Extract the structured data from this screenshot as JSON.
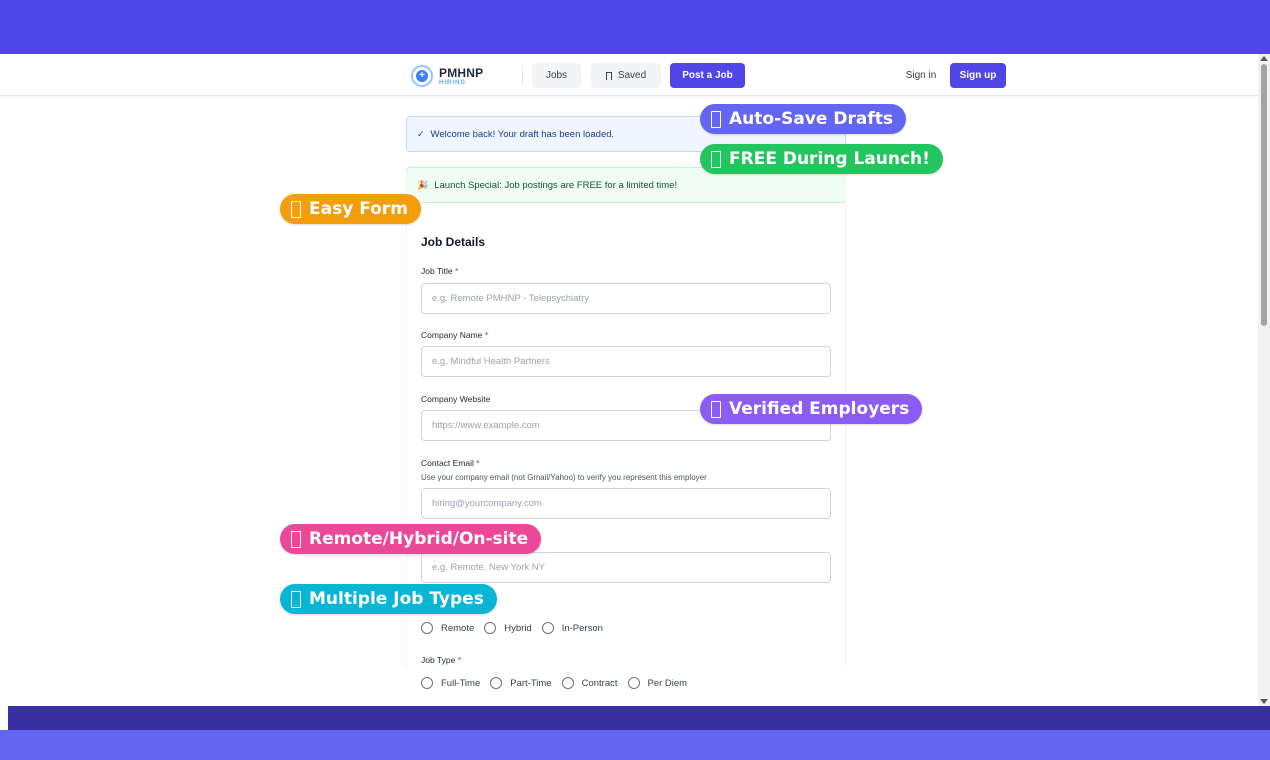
{
  "navbar": {
    "logo_title": "PMHNP",
    "logo_subtitle": "HIRING",
    "jobs_label": "Jobs",
    "saved_label": "Saved",
    "post_job_label": "Post a Job",
    "sign_in_label": "Sign in",
    "sign_up_label": "Sign up"
  },
  "alerts": {
    "welcome_icon": "✓",
    "welcome_text": "Welcome back! Your draft has been loaded.",
    "launch_icon": "🎉",
    "launch_text": "Launch Special: Job postings are FREE for a limited time!"
  },
  "form": {
    "section_title": "Job Details",
    "job_title_label": "Job Title",
    "job_title_placeholder": "e.g. Remote PMHNP - Telepsychiatry",
    "company_name_label": "Company Name",
    "company_name_placeholder": "e.g. Mindful Health Partners",
    "company_website_label": "Company Website",
    "company_website_placeholder": "https://www.example.com",
    "contact_email_label": "Contact Email",
    "contact_email_help": "Use your company email (not Gmail/Yahoo) to verify you represent this employer",
    "contact_email_placeholder": "hiring@yourcompany.com",
    "location_placeholder": "e.g. Remote, New York NY",
    "work_mode_options": [
      "Remote",
      "Hybrid",
      "In-Person"
    ],
    "job_type_label": "Job Type",
    "job_type_options": [
      "Full-Time",
      "Part-Time",
      "Contract",
      "Per Diem"
    ],
    "required_mark": "*"
  },
  "badges": {
    "auto_save": "Auto-Save Drafts",
    "free_launch": "FREE During Launch!",
    "easy_form": "Easy Form",
    "verified": "Verified Employers",
    "remote_hybrid": "Remote/Hybrid/On-site",
    "job_types": "Multiple Job Types"
  },
  "colors": {
    "brand": "#4f46e5",
    "badge_indigo": "#6366f1",
    "badge_green": "#22c55e",
    "badge_amber": "#f59e0b",
    "badge_purple": "#8b5cf6",
    "badge_pink": "#ec4899",
    "badge_cyan": "#06b6d4"
  }
}
